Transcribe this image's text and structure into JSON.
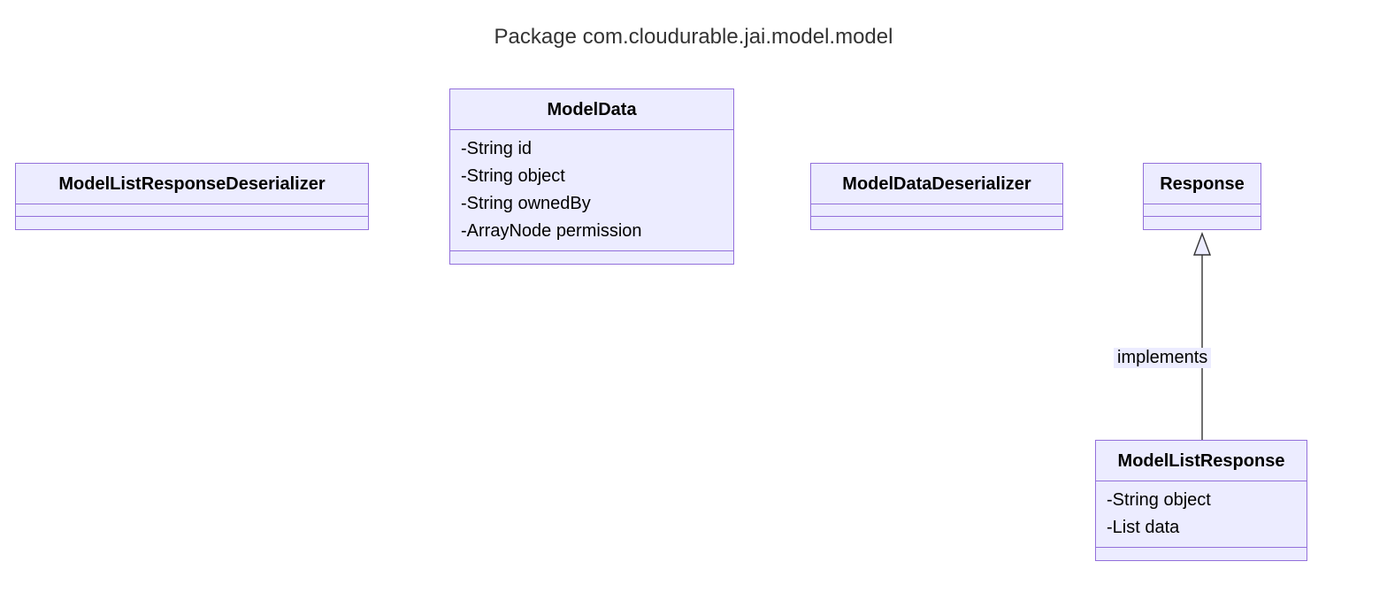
{
  "title": "Package com.cloudurable.jai.model.model",
  "classes": {
    "mlrd": {
      "name": "ModelListResponseDeserializer"
    },
    "modelData": {
      "name": "ModelData",
      "attrs": [
        "-String id",
        "-String object",
        "-String ownedBy",
        "-ArrayNode permission"
      ]
    },
    "mdd": {
      "name": "ModelDataDeserializer"
    },
    "response": {
      "name": "Response"
    },
    "mlr": {
      "name": "ModelListResponse",
      "attrs": [
        "-String object",
        "-List data"
      ]
    }
  },
  "relation": {
    "label": "implements"
  }
}
